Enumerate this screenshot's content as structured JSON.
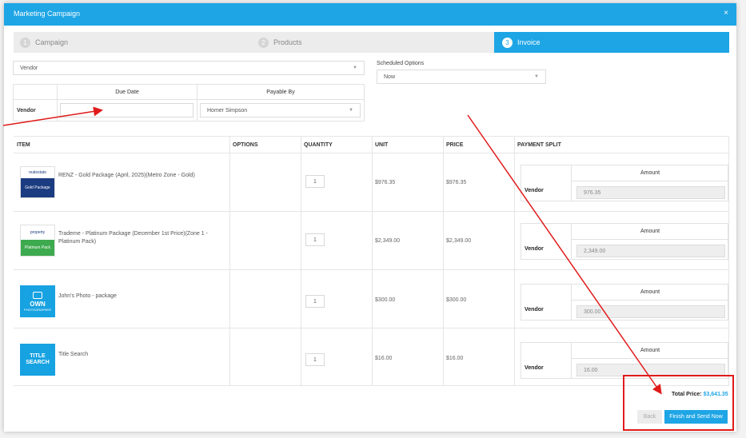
{
  "modal": {
    "title": "Marketing Campaign",
    "close": "×"
  },
  "steps": [
    {
      "num": "1",
      "label": "Campaign"
    },
    {
      "num": "2",
      "label": "Products"
    },
    {
      "num": "3",
      "label": "Invoice"
    }
  ],
  "vendor_select": {
    "value": "Vendor"
  },
  "scheduled": {
    "label": "Scheduled Options",
    "value": "Now"
  },
  "vendor_grid": {
    "headers": {
      "due_date": "Due Date",
      "payable_by": "Payable By"
    },
    "row_label": "Vendor",
    "due_date_value": "",
    "payable_by_value": "Homer Simpson"
  },
  "items_table": {
    "headers": [
      "ITEM",
      "OPTIONS",
      "QUANTITY",
      "UNIT",
      "PRICE",
      "PAYMENT SPLIT"
    ],
    "amount_header": "Amount",
    "vendor_label": "Vendor",
    "rows": [
      {
        "name": "RENZ - Gold Package (April, 2025)(Metro Zone - Gold)",
        "thumb_text_top": "realestate",
        "thumb_text": "Gold Package",
        "quantity": "1",
        "unit": "$976.35",
        "price": "$976.35",
        "amount": "976.35"
      },
      {
        "name": "Trademe - Platinum Package (December 1st Price)(Zone 1 - Platinum Pack)",
        "thumb_text_top": "property",
        "thumb_text": "Platinum Pack",
        "quantity": "1",
        "unit": "$2,349.00",
        "price": "$2,349.00",
        "amount": "2,349.00"
      },
      {
        "name": "John's Photo - package",
        "thumb_text_top": "OWN",
        "thumb_text": "PHOTOGRAPHER",
        "quantity": "1",
        "unit": "$300.00",
        "price": "$300.00",
        "amount": "300.00"
      },
      {
        "name": "Title Search",
        "thumb_text_top": "TITLE",
        "thumb_text": "SEARCH",
        "quantity": "1",
        "unit": "$16.00",
        "price": "$16.00",
        "amount": "16.00"
      }
    ]
  },
  "total": {
    "label": "Total Price:",
    "value": "$3,641.35"
  },
  "buttons": {
    "back": "Back",
    "finish": "Finish and Send Now"
  },
  "colors": {
    "accent": "#1ea5e5",
    "annotation": "#e01b1b"
  }
}
